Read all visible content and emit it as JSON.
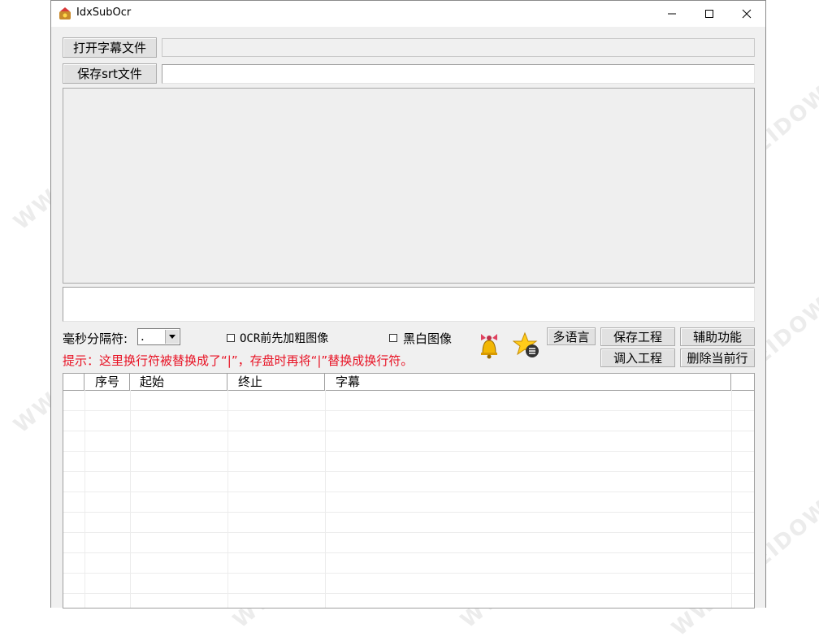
{
  "window": {
    "title": "IdxSubOcr",
    "controls": {
      "minimize": "—",
      "maximize": "☐",
      "close": "✕"
    }
  },
  "file": {
    "open_button": "打开字幕文件",
    "open_path": "",
    "save_button": "保存srt文件",
    "save_path": ""
  },
  "preview": {
    "ocr_text": ""
  },
  "options": {
    "ms_separator_label": "毫秒分隔符:",
    "ms_separator_value": ".",
    "ocr_bold_label": "OCR前先加粗图像",
    "ocr_bold_checked": false,
    "bw_label": "黑白图像",
    "bw_checked": false,
    "hint": "提示：这里换行符被替换成了“|”，存盘时再将“|”替换成换行符。",
    "hint_color": "#e81123"
  },
  "buttons": {
    "language": "多语言",
    "save_project": "保存工程",
    "aux": "辅助功能",
    "load_project": "调入工程",
    "delete_row": "删除当前行"
  },
  "icons": {
    "bell": "bell-icon",
    "star": "star-menu-icon"
  },
  "table": {
    "columns": [
      "",
      "序号",
      "起始",
      "终止",
      "字幕"
    ],
    "rows": []
  },
  "watermark": "WWW.WEIDOWN.COM"
}
